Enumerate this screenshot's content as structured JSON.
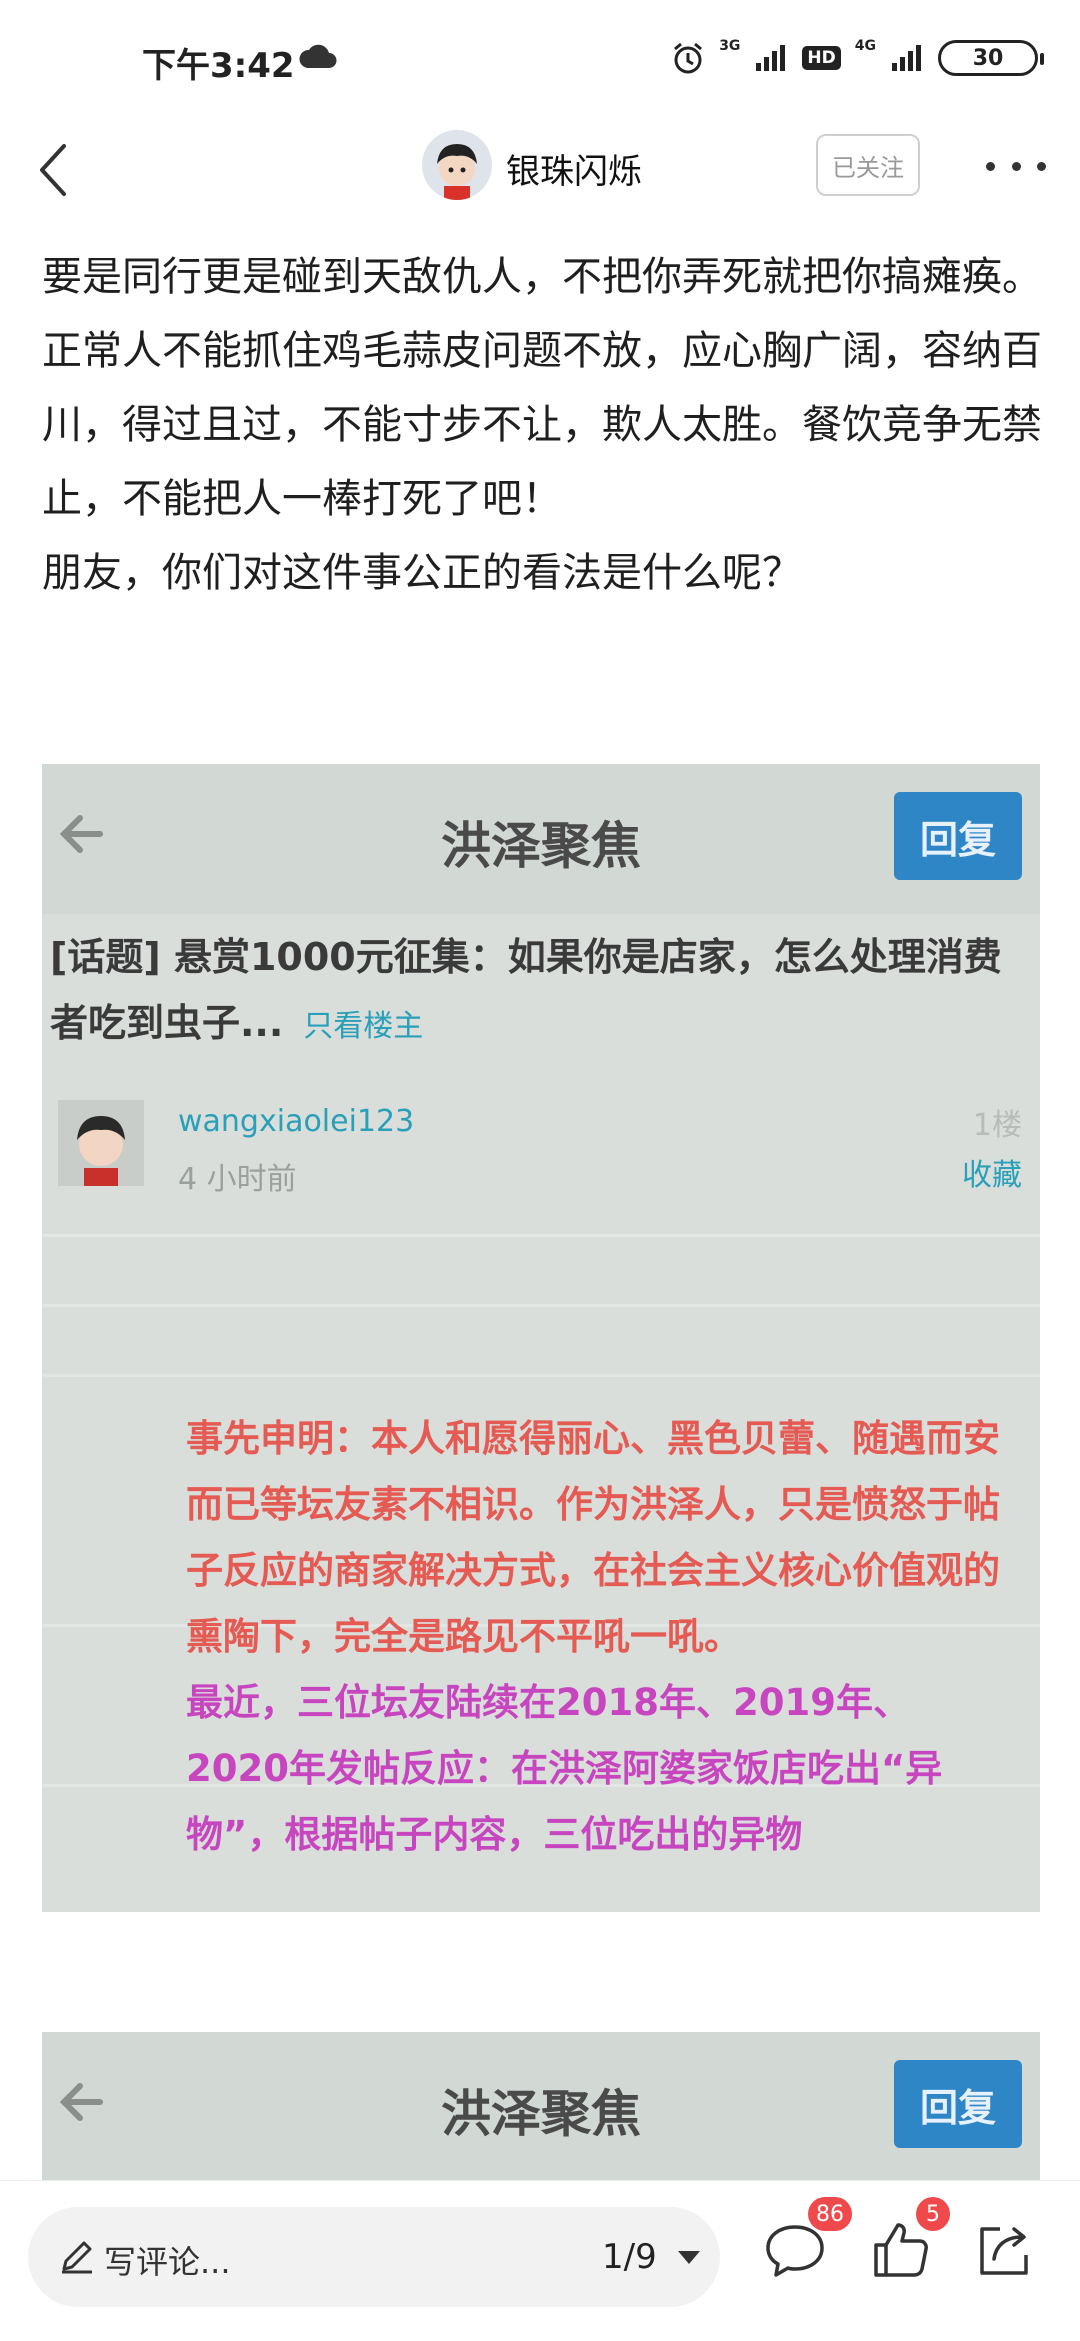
{
  "status_bar": {
    "time": "下午3:42",
    "network_1": "3G",
    "hd": "HD",
    "network_2": "4G",
    "battery": "30"
  },
  "header": {
    "username": "银珠闪烁",
    "follow_label": "已关注"
  },
  "article": {
    "paragraphs": [
      "要是同行更是碰到天敌仇人，不把你弄死就把你搞瘫痪。正常人不能抓住鸡毛蒜皮问题不放，应心胸广阔，容纳百川，得过且过，不能寸步不让，欺人太胜。餐饮竞争无禁止，不能把人一棒打死了吧！",
      "朋友，你们对这件事公正的看法是什么呢？"
    ]
  },
  "screenshot_1": {
    "title": "洪泽聚焦",
    "reply": "回复",
    "topic": "[话题] 悬赏1000元征集：如果你是店家，怎么处理消费者吃到虫子...",
    "only_op": "只看楼主",
    "user": "wangxiaolei123",
    "time": "4 小时前",
    "floor": "1楼",
    "favorite": "收藏",
    "red_text": "事先申明：本人和愿得丽心、黑色贝蕾、随遇而安而已等坛友素不相识。作为洪泽人，只是愤怒于帖子反应的商家解决方式，在社会主义核心价值观的熏陶下，完全是路见不平吼一吼。",
    "pink_text": "最近，三位坛友陆续在2018年、2019年、2020年发帖反应：在洪泽阿婆家饭店吃出“异物”，根据帖子内容，三位吃出的异物"
  },
  "screenshot_2": {
    "title": "洪泽聚焦",
    "reply": "回复"
  },
  "bottom_bar": {
    "comment_placeholder": "写评论...",
    "pager": "1/9",
    "comment_count": "86",
    "like_count": "5"
  },
  "icons": {
    "back": "chevron-left-icon",
    "more": "more-dots-icon",
    "pen": "pen-icon",
    "comment": "comment-icon",
    "like": "thumbs-up-icon",
    "share": "share-icon"
  }
}
